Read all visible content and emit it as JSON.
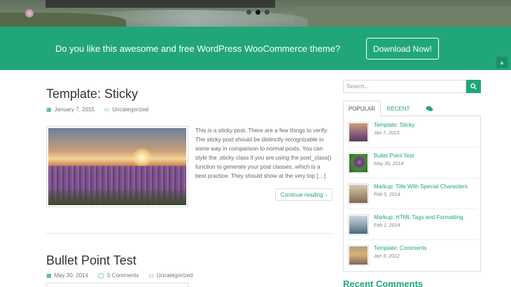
{
  "slider": {
    "dots": 3,
    "active_dot": 1
  },
  "promo": {
    "text": "Do you like this awesome and free WordPress WooCommerce theme?",
    "button_label": "Download Now!"
  },
  "posts": [
    {
      "title": "Template: Sticky",
      "date": "January 7, 2015",
      "category": "Uncategorized",
      "excerpt": "This is a sticky post. There are a few things to verify: The sticky post should be distinctly recognizable in some way in comparison to normal posts. You can style the .sticky class if you are using the post_class() function to generate your post classes, which is a best practice. They should show at the very top […]",
      "continue_label": "Continue reading"
    },
    {
      "title": "Bullet Point Test",
      "date": "May 30, 2014",
      "comments": "5 Comments",
      "category": "Uncategorized"
    }
  ],
  "sidebar": {
    "search_placeholder": "Search...",
    "tabs": [
      "POPULAR",
      "RECENT"
    ],
    "active_tab": 0,
    "popular": [
      {
        "title": "Template: Sticky",
        "date": "Jan 7, 2015"
      },
      {
        "title": "Bullet Point Test",
        "date": "May 30, 2014"
      },
      {
        "title": "Markup: Title With Special Characters",
        "date": "Feb 5, 2014"
      },
      {
        "title": "Markup: HTML Tags and Formatting",
        "date": "Feb 1, 2014"
      },
      {
        "title": "Template: Comments",
        "date": "Jan 3, 2012"
      }
    ],
    "recent_comments_heading": "Recent Comments"
  },
  "colors": {
    "accent": "#21a67a"
  }
}
